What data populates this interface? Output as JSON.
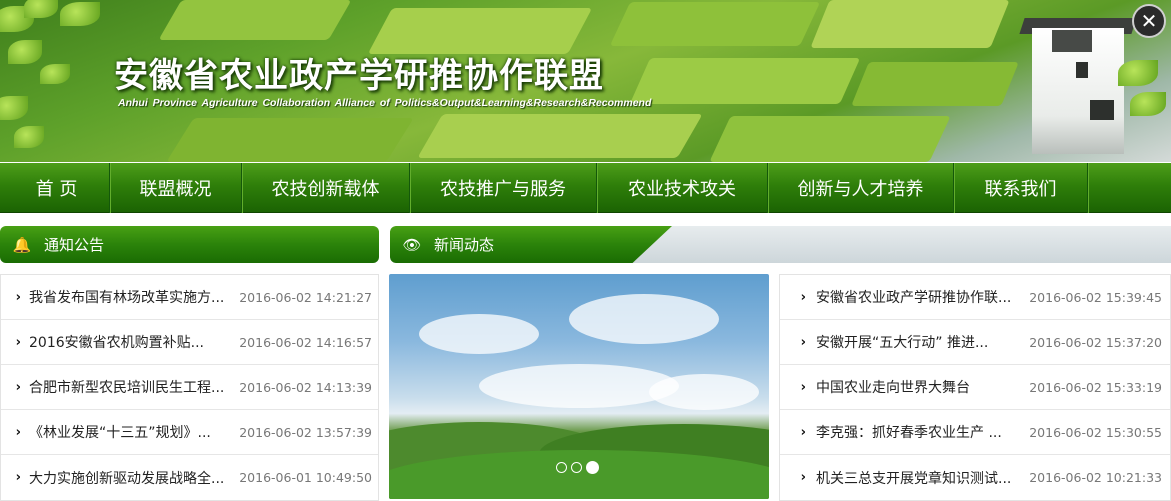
{
  "banner": {
    "title_cn": "安徽省农业政产学研推协作联盟",
    "title_en": "Anhui Province Agriculture Collaboration Alliance of Politics&Output&Learning&Research&Recommend",
    "close_label": "✕"
  },
  "nav": {
    "items": [
      {
        "label": "首 页"
      },
      {
        "label": "联盟概况"
      },
      {
        "label": "农技创新载体"
      },
      {
        "label": "农技推广与服务"
      },
      {
        "label": "农业技术攻关"
      },
      {
        "label": "创新与人才培养"
      },
      {
        "label": "联系我们"
      }
    ]
  },
  "notice": {
    "title": "通知公告",
    "icon": "bell-icon",
    "items": [
      {
        "title": "我省发布国有林场改革实施方...",
        "date": "2016-06-02 14:21:27"
      },
      {
        "title": "2016安徽省农机购置补贴...",
        "date": "2016-06-02 14:16:57"
      },
      {
        "title": "合肥市新型农民培训民生工程...",
        "date": "2016-06-02 14:13:39"
      },
      {
        "title": "《林业发展“十三五”规划》...",
        "date": "2016-06-02 13:57:39"
      },
      {
        "title": "大力实施创新驱动发展战略全...",
        "date": "2016-06-01 10:49:50"
      }
    ]
  },
  "news": {
    "title": "新闻动态",
    "icon": "eye-icon",
    "items": [
      {
        "title": "安徽省农业政产学研推协作联...",
        "date": "2016-06-02 15:39:45"
      },
      {
        "title": "安徽开展“五大行动” 推进...",
        "date": "2016-06-02 15:37:20"
      },
      {
        "title": "中国农业走向世界大舞台",
        "date": "2016-06-02 15:33:19"
      },
      {
        "title": "李克强：抓好春季农业生产 ...",
        "date": "2016-06-02 15:30:55"
      },
      {
        "title": "机关三总支开展党章知识测试...",
        "date": "2016-06-02 10:21:33"
      }
    ]
  },
  "carousel": {
    "slide_count": 3,
    "active_index": 2
  },
  "icons": {
    "chevron": "›",
    "bell": "🔔",
    "eye": "👁"
  },
  "colors": {
    "nav_green": "#2f7f0a",
    "header_green": "#2b830a"
  }
}
